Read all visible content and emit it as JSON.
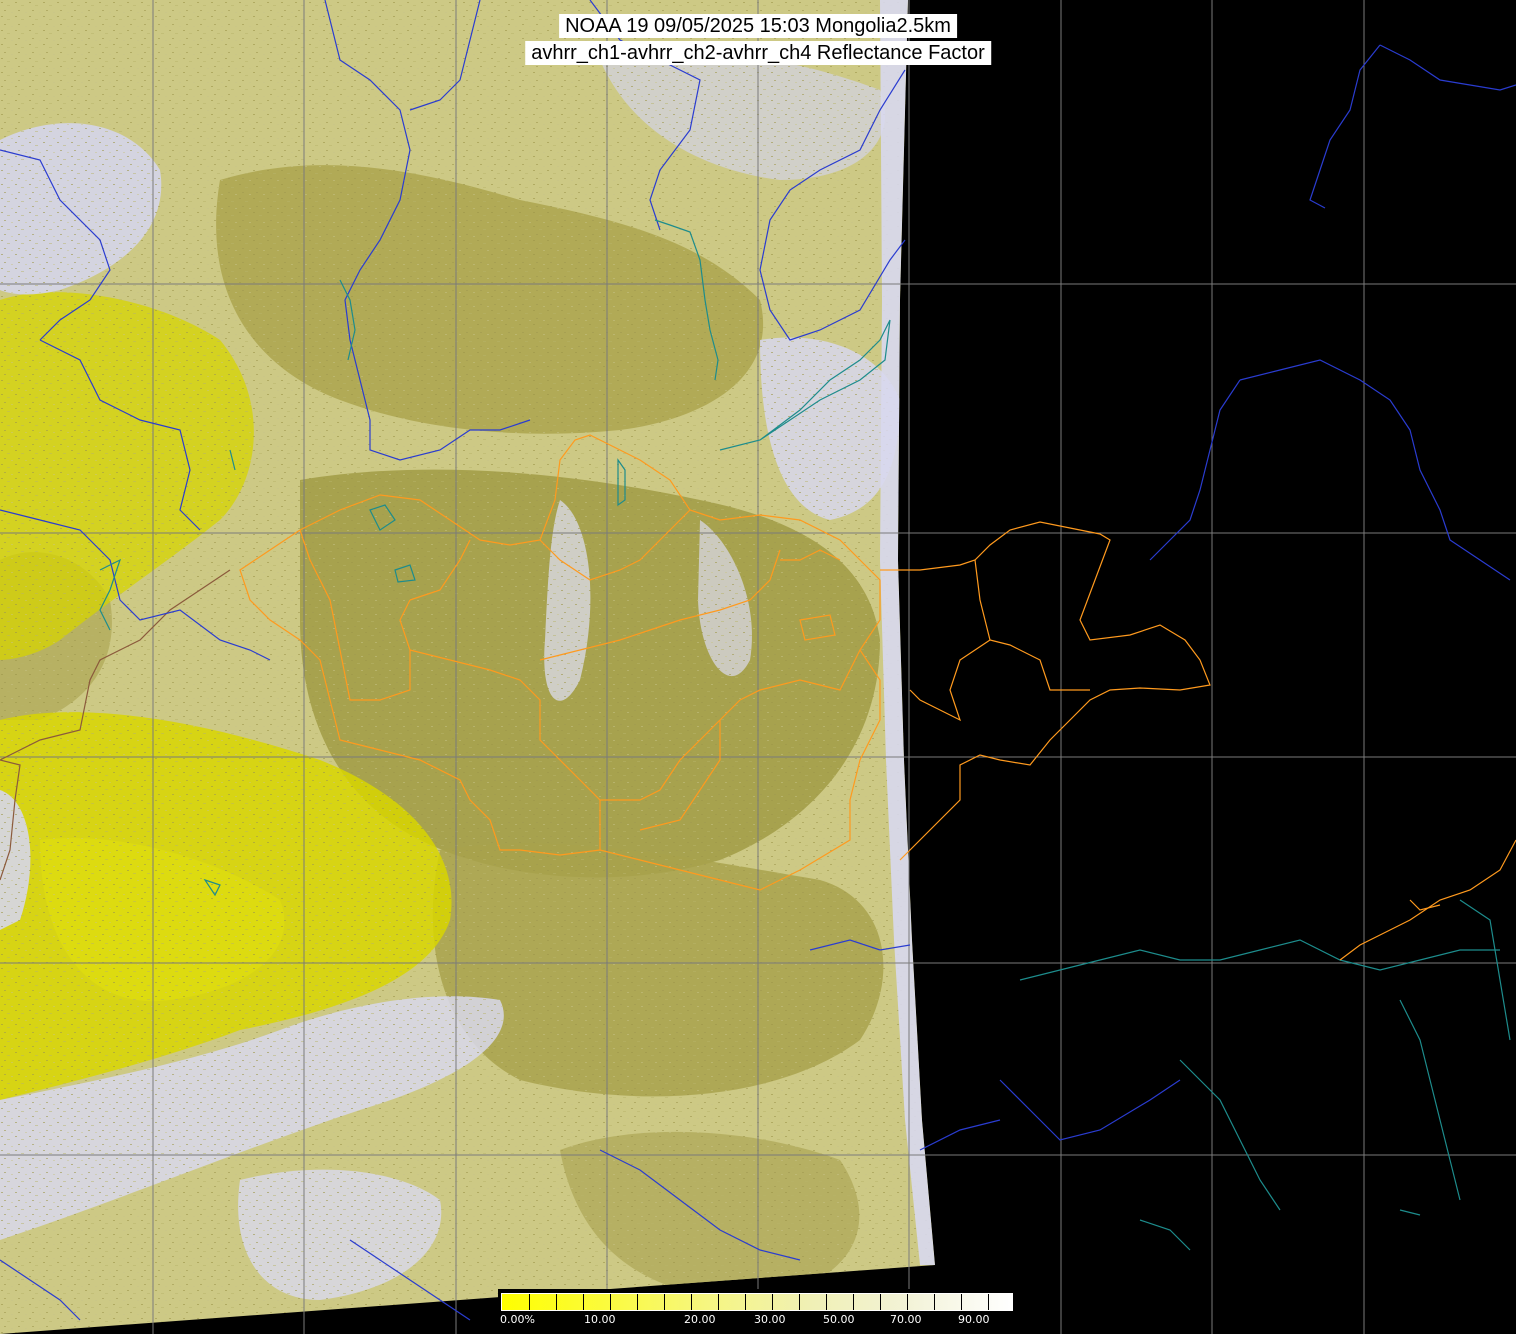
{
  "title": {
    "line1": "NOAA 19 09/05/2025 15:03 Mongolia2.5km",
    "line2": "avhrr_ch1-avhrr_ch2-avhrr_ch4 Reflectance Factor"
  },
  "colorbar": {
    "labels": [
      "0.00%",
      "10.00",
      "20.00",
      "30.00",
      "50.00",
      "70.00",
      "90.00"
    ],
    "colors": [
      "#ffff00",
      "#fbfb3c",
      "#f6f680",
      "#f0f0b4",
      "#f3f3d8",
      "#ffffff"
    ]
  },
  "colors": {
    "background": "#000000",
    "land_olive": "#a8a24a",
    "land_khaki": "#cfcb86",
    "bright_yellow": "#d9d800",
    "cloud_lavender": "#d6d6ec",
    "graticule": "#7a7a7a",
    "rivers": "#2a3cd0",
    "admin_borders": "#ff9a1e",
    "coastline": "#1d8c8c",
    "intl_border": "#8b5a3c"
  }
}
